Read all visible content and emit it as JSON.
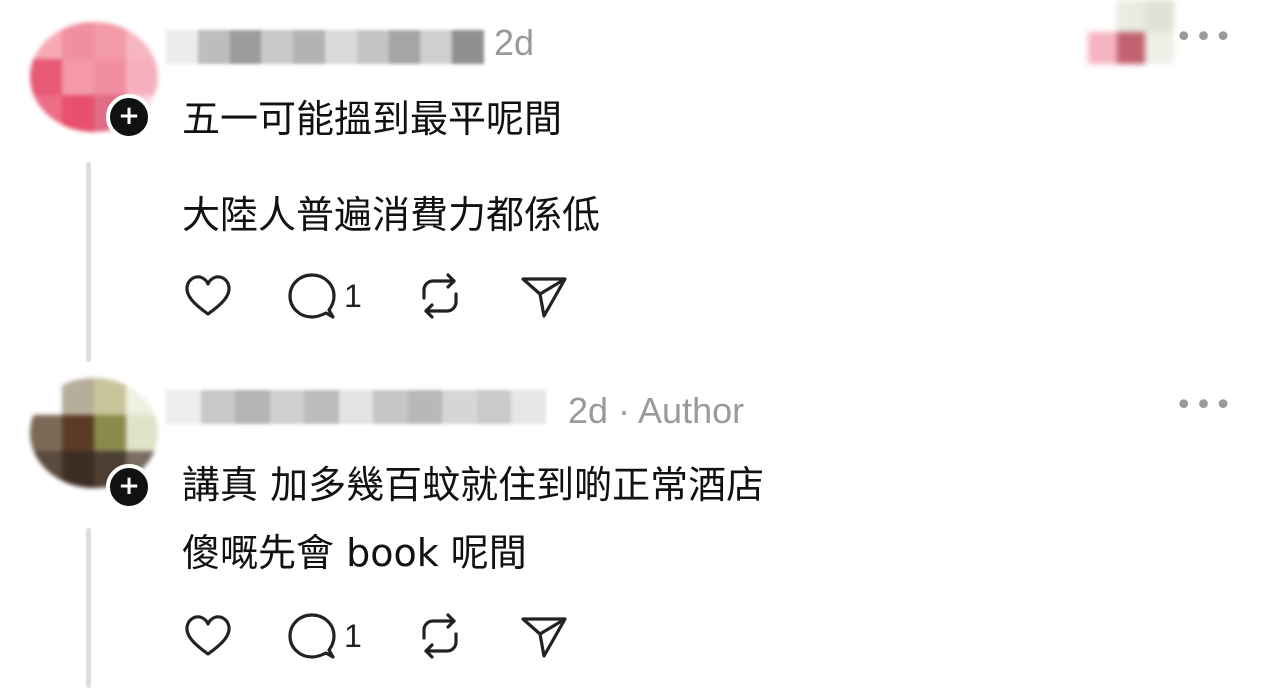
{
  "posts": [
    {
      "time": "2d",
      "line1": "五一可能搵到最平呢間",
      "line2": "大陸人普遍消費力都係低",
      "reply_count": "1",
      "more_icon": "more-horizontal-icon"
    },
    {
      "time": "2d · Author",
      "line1": "講真 加多幾百蚊就住到啲正常酒店",
      "line2": "傻嘅先會 book 呢間",
      "reply_count": "1",
      "more_icon": "more-horizontal-icon"
    }
  ],
  "more_label": "•••",
  "badge_label": "+",
  "icons": {
    "like": "heart-icon",
    "reply": "comment-icon",
    "repost": "repost-icon",
    "share": "send-icon"
  },
  "colors": {
    "text": "#111111",
    "meta": "#9a9a9a",
    "thread_line": "#dedede"
  }
}
